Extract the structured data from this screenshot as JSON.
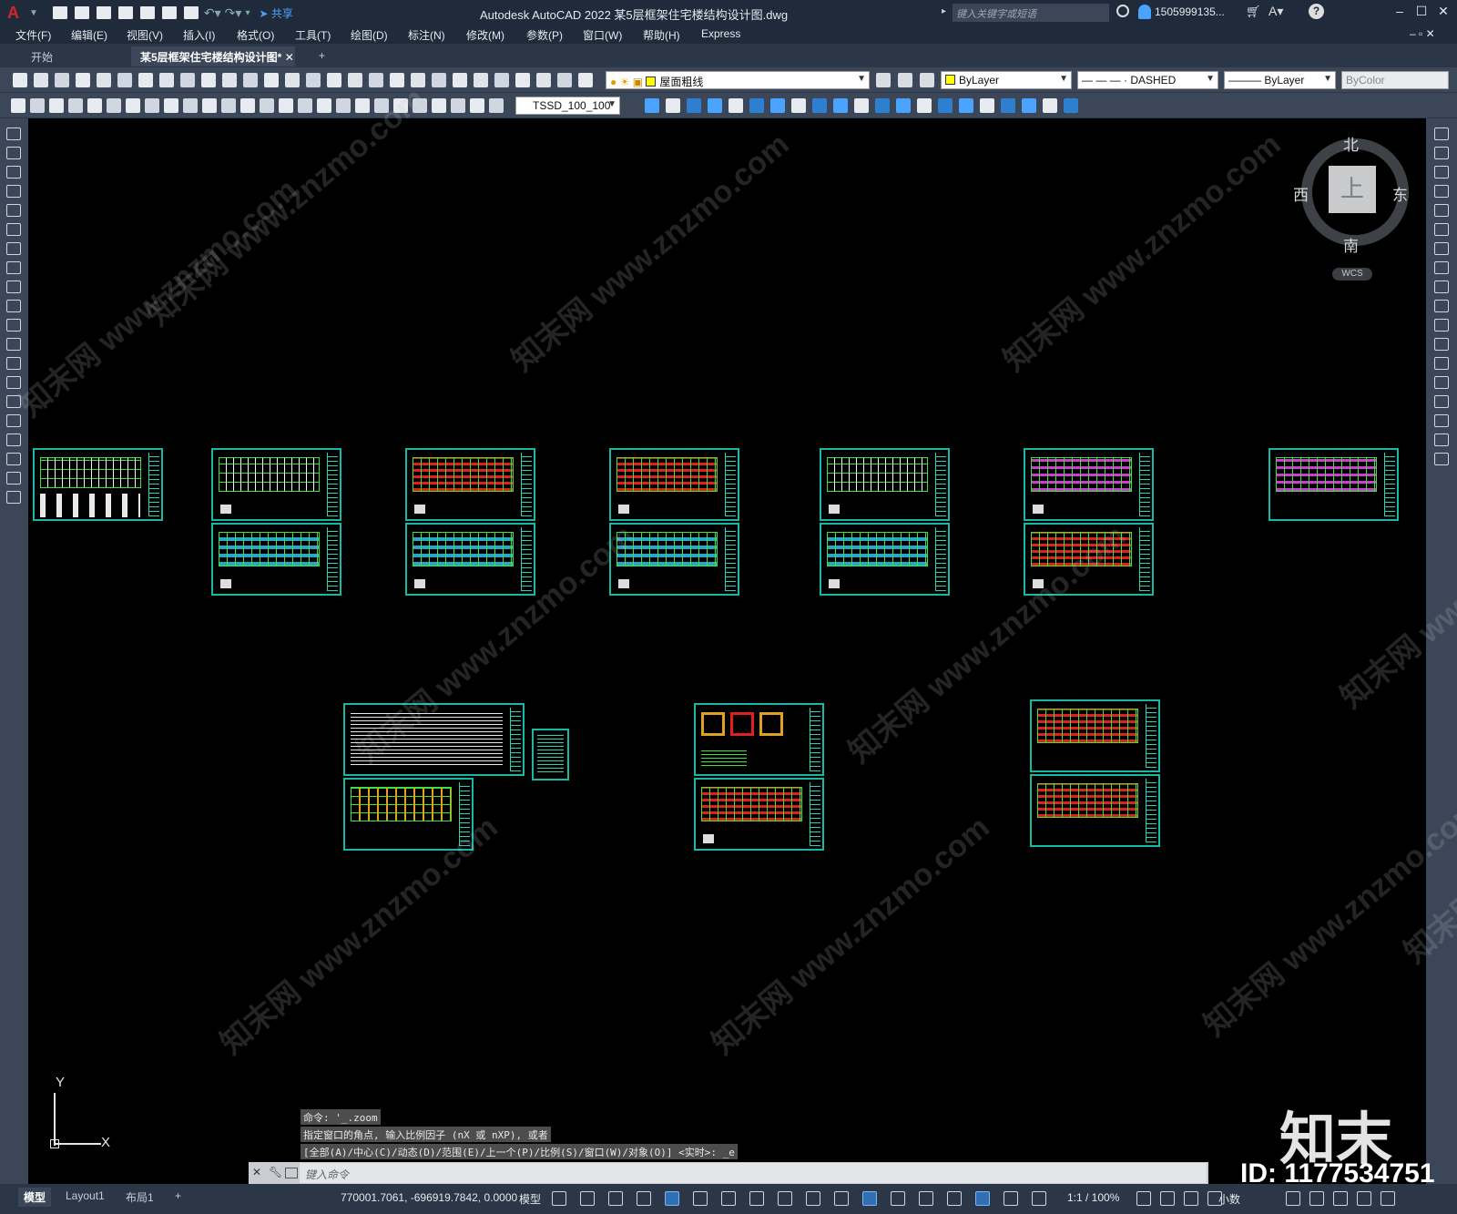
{
  "titlebar": {
    "app_logo": "A",
    "share_label": "共享",
    "title": "Autodesk AutoCAD 2022    某5层框架住宅楼结构设计图.dwg",
    "search_placeholder": "键入关键字或短语",
    "user": "1505999135...",
    "help": "?"
  },
  "menu": [
    "文件(F)",
    "编辑(E)",
    "视图(V)",
    "插入(I)",
    "格式(O)",
    "工具(T)",
    "绘图(D)",
    "标注(N)",
    "修改(M)",
    "参数(P)",
    "窗口(W)",
    "帮助(H)",
    "Express"
  ],
  "tabs": [
    {
      "label": "开始",
      "active": false
    },
    {
      "label": "某5层框架住宅楼结构设计图*",
      "active": true
    },
    {
      "label": "+",
      "active": false
    }
  ],
  "toolbar_row1": {
    "layer_name": "屋面粗线",
    "layer_color": "#ffff00",
    "color_value": "ByLayer",
    "linetype_value": "— — — · DASHED",
    "lineweight_value": "——— ByLayer",
    "plotstyle_value": "ByColor"
  },
  "toolbar_row2": {
    "dimstyle_value": "TSSD_100_100"
  },
  "viewcube": {
    "north": "北",
    "south": "南",
    "east": "东",
    "west": "西",
    "face": "上",
    "wcs": "WCS"
  },
  "ucs": {
    "y": "Y",
    "x": "X"
  },
  "command": {
    "history": [
      "命令: '_.zoom",
      "指定窗口的角点, 输入比例因子 (nX 或 nXP), 或者",
      "[全部(A)/中心(C)/动态(D)/范围(E)/上一个(P)/比例(S)/窗口(W)/对象(O)] <实时>: _e"
    ],
    "input_placeholder": "键入命令"
  },
  "statusbar": {
    "layout_tabs": [
      {
        "label": "模型",
        "active": true
      },
      {
        "label": "Layout1",
        "active": false
      },
      {
        "label": "布局1",
        "active": false
      },
      {
        "label": "+",
        "active": false
      }
    ],
    "coordinates": "770001.7061, -696919.7842, 0.0000",
    "mode": "模型",
    "scale": "1:1 / 100%",
    "units": "小数"
  },
  "watermark": {
    "text": "知末网 www.znzmo.com",
    "brand": "知末",
    "id": "ID: 1177534751"
  },
  "colors": {
    "frame": "#17b9a5",
    "grid_green": "#39e53b",
    "accent_red": "#e02020",
    "accent_cyan": "#2aa5c9",
    "accent_magenta": "#d03ad0",
    "ui_dark": "#1f2b3b",
    "ui_mid": "#3b4758"
  }
}
